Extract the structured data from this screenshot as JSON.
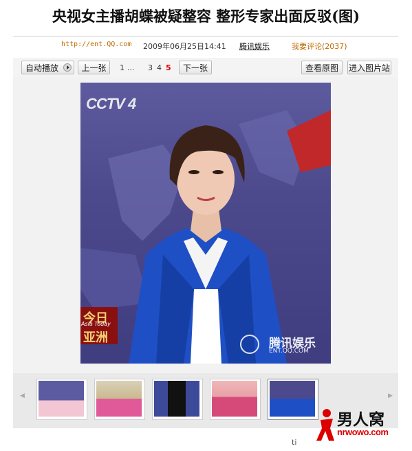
{
  "page": {
    "title": "央视女主播胡蝶被疑整容 整形专家出面反驳(图)"
  },
  "meta": {
    "url": "http://ent.QQ.com",
    "datetime": "2009年06月25日14:41",
    "source": "腾讯娱乐",
    "comment": "我要评论(2037)"
  },
  "toolbar": {
    "autoplay_label": "自动播放",
    "prev_label": "上一张",
    "pages": [
      "1",
      "...",
      "3",
      "4",
      "5"
    ],
    "current_page": "5",
    "next_label": "下一张",
    "view_original_label": "查看原图",
    "enter_gallery_label": "进入图片站"
  },
  "photo": {
    "channel_logo": "CCTV 4",
    "program_top": "今日",
    "program_mid": "Asia Today",
    "program_bottom": "亚洲",
    "watermark_cn": "腾讯娱乐",
    "watermark_en": "ENT.QQ.COM"
  },
  "thumbnails": {
    "count_visible": 5,
    "selected_index": 4
  },
  "brand": {
    "name_cn": "男人窝",
    "name_en": "nrwowo.com",
    "footer_partial": "ti"
  },
  "colors": {
    "accent_orange": "#c06a00",
    "current_page_red": "#dd0000",
    "jacket_blue": "#1f4fc4",
    "backdrop_purple": "#4c4a8c",
    "asia_red": "#8a1010"
  }
}
